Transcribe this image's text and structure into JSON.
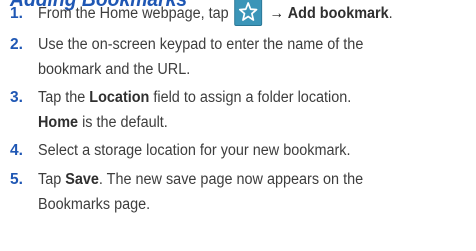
{
  "heading": "Adding Bookmarks",
  "steps": [
    {
      "number": "1.",
      "line1_text": "From the Home webpage, tap",
      "icon": "bookmark-star-icon",
      "arrow": "→",
      "line1_bold": "Add bookmark",
      "line1_end": "."
    },
    {
      "number": "2.",
      "line1": "Use the on-screen keypad to enter the name of the",
      "line2": "bookmark and the URL."
    },
    {
      "number": "3.",
      "line1_pre": "Tap the ",
      "line1_bold": "Location",
      "line1_post": " field to assign a folder location.",
      "line2_bold": "Home",
      "line2_post": " is the default."
    },
    {
      "number": "4.",
      "line1": "Select a storage location for your new bookmark."
    },
    {
      "number": "5.",
      "line1_pre": "Tap ",
      "line1_bold": "Save",
      "line1_post": ". The new save page now appears on the",
      "line2": "Bookmarks page."
    }
  ],
  "colors": {
    "heading": "#1f57b4",
    "step_number": "#1f57b4",
    "body_text": "#3d3d3d",
    "icon_background": "#3b95b8"
  }
}
